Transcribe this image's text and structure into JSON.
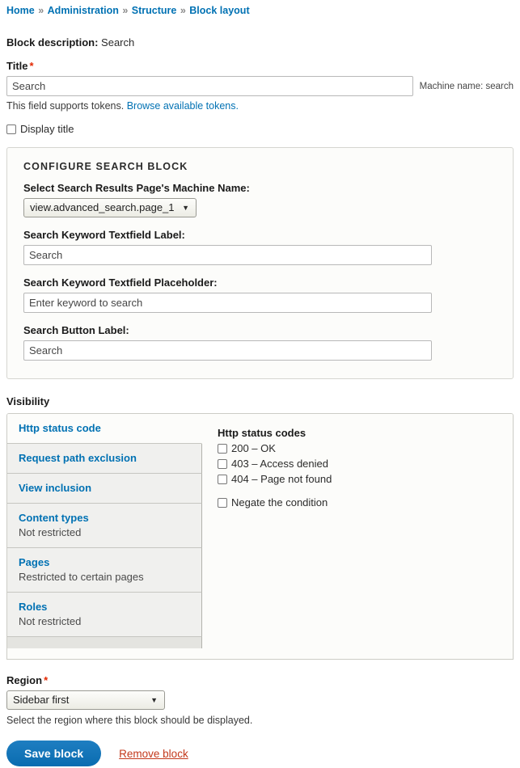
{
  "breadcrumb": {
    "separator": "»",
    "items": [
      {
        "label": "Home"
      },
      {
        "label": "Administration"
      },
      {
        "label": "Structure"
      },
      {
        "label": "Block layout"
      }
    ]
  },
  "block_description": {
    "label": "Block description:",
    "value": "Search"
  },
  "title_field": {
    "label": "Title",
    "required_marker": "*",
    "value": "Search",
    "machine_name": "Machine name: search",
    "help_text": "This field supports tokens.",
    "help_link": "Browse available tokens."
  },
  "display_title": {
    "label": "Display title",
    "checked": false
  },
  "configure_block": {
    "title": "CONFIGURE SEARCH BLOCK",
    "results_page": {
      "label": "Select Search Results Page's Machine Name:",
      "value": "view.advanced_search.page_1",
      "options": [
        "view.advanced_search.page_1"
      ]
    },
    "keyword_label": {
      "label": "Search Keyword Textfield Label:",
      "value": "Search"
    },
    "keyword_placeholder": {
      "label": "Search Keyword Textfield Placeholder:",
      "value": "Enter keyword to search"
    },
    "button_label": {
      "label": "Search Button Label:",
      "value": "Search"
    }
  },
  "visibility": {
    "heading": "Visibility",
    "tabs": [
      {
        "title": "Http status code",
        "summary": "",
        "active": true
      },
      {
        "title": "Request path exclusion",
        "summary": "",
        "active": false
      },
      {
        "title": "View inclusion",
        "summary": "",
        "active": false
      },
      {
        "title": "Content types",
        "summary": "Not restricted",
        "active": false
      },
      {
        "title": "Pages",
        "summary": "Restricted to certain pages",
        "active": false
      },
      {
        "title": "Roles",
        "summary": "Not restricted",
        "active": false
      }
    ],
    "pane": {
      "heading": "Http status codes",
      "options": [
        {
          "label": "200 – OK",
          "checked": false
        },
        {
          "label": "403 – Access denied",
          "checked": false
        },
        {
          "label": "404 – Page not found",
          "checked": false
        }
      ],
      "negate": {
        "label": "Negate the condition",
        "checked": false
      }
    }
  },
  "region": {
    "label": "Region",
    "required_marker": "*",
    "value": "Sidebar first",
    "options": [
      "Sidebar first"
    ],
    "description": "Select the region where this block should be displayed."
  },
  "actions": {
    "save_label": "Save block",
    "remove_label": "Remove block"
  },
  "colors": {
    "link": "#0071b3",
    "required": "#e32700",
    "primary_button": "#0a6cb0",
    "destructive": "#c3381b"
  }
}
